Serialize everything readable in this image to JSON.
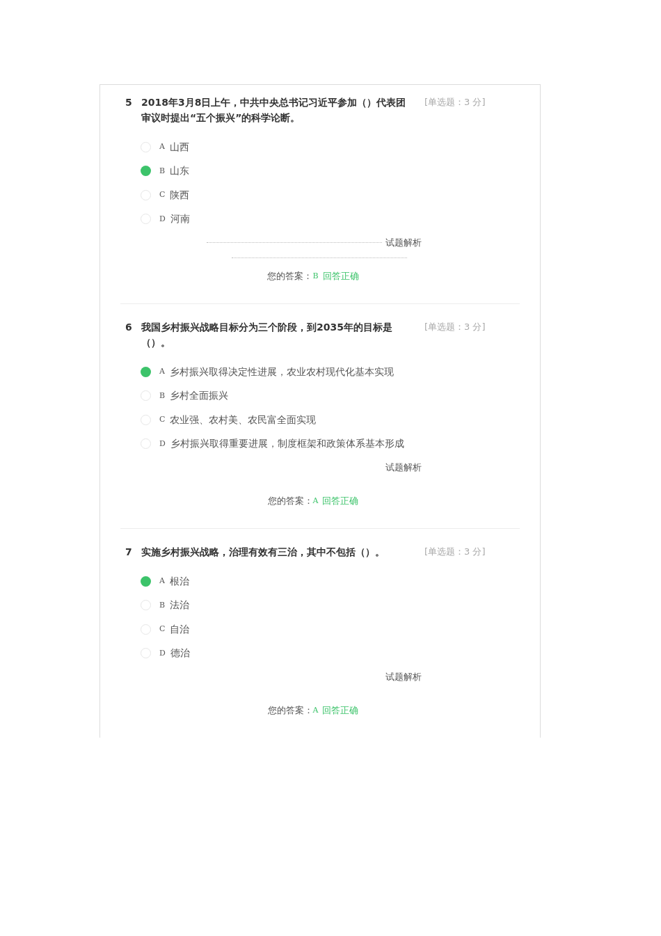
{
  "questions": [
    {
      "number": "5",
      "text": "2018年3月8日上午，中共中央总书记习近平参加（）代表团审议时提出“五个振兴”的科学论断。",
      "tag": "[单选题：3 分]",
      "dotted_lines": true,
      "options": [
        {
          "letter": "A",
          "text": "山西",
          "selected": false
        },
        {
          "letter": "B",
          "text": "山东",
          "selected": true
        },
        {
          "letter": "C",
          "text": "陕西",
          "selected": false
        },
        {
          "letter": "D",
          "text": "河南",
          "selected": false
        }
      ],
      "analysis": "试题解析",
      "answer_label": "您的答案：",
      "answer": "B",
      "result": "回答正确"
    },
    {
      "number": "6",
      "text": "我国乡村振兴战略目标分为三个阶段，到2035年的目标是（）。",
      "tag": "[单选题：3 分]",
      "dotted_lines": false,
      "options": [
        {
          "letter": "A",
          "text": "乡村振兴取得决定性进展，农业农村现代化基本实现",
          "selected": true
        },
        {
          "letter": "B",
          "text": "乡村全面振兴",
          "selected": false
        },
        {
          "letter": "C",
          "text": "农业强、农村美、农民富全面实现",
          "selected": false
        },
        {
          "letter": "D",
          "text": "乡村振兴取得重要进展，制度框架和政策体系基本形成",
          "selected": false
        }
      ],
      "analysis": "试题解析",
      "answer_label": "您的答案：",
      "answer": "A",
      "result": "回答正确"
    },
    {
      "number": "7",
      "text": "实施乡村振兴战略，治理有效有三治，其中不包括（）。",
      "tag": "[单选题：3 分]",
      "dotted_lines": false,
      "options": [
        {
          "letter": "A",
          "text": "根治",
          "selected": true
        },
        {
          "letter": "B",
          "text": "法治",
          "selected": false
        },
        {
          "letter": "C",
          "text": "自治",
          "selected": false
        },
        {
          "letter": "D",
          "text": "德治",
          "selected": false
        }
      ],
      "analysis": "试题解析",
      "answer_label": "您的答案：",
      "answer": "A",
      "result": "回答正确"
    }
  ]
}
